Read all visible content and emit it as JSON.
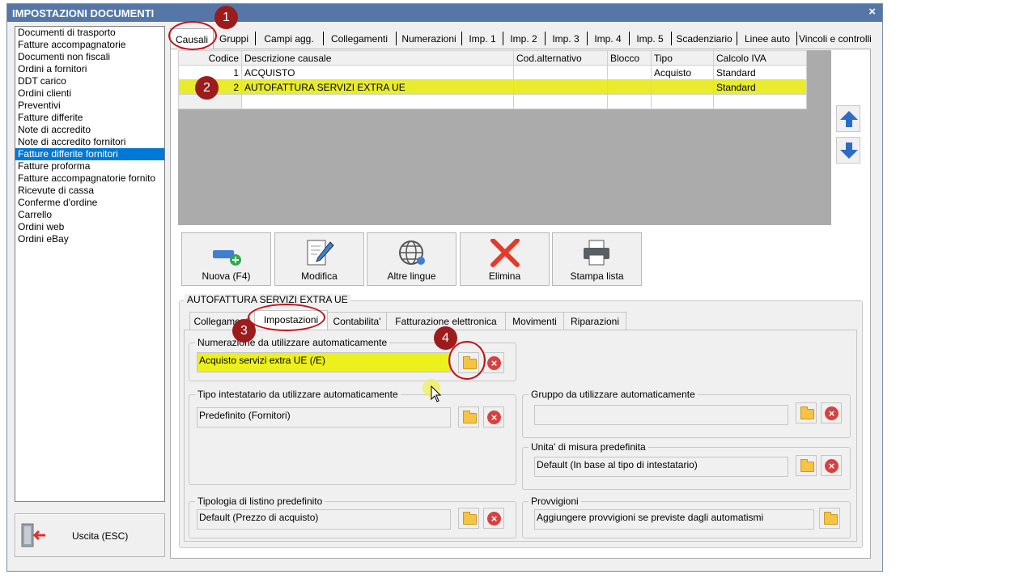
{
  "window": {
    "title": "IMPOSTAZIONI DOCUMENTI",
    "close": "×"
  },
  "doc_list": [
    "Documenti di trasporto",
    "Fatture accompagnatorie",
    "Documenti non fiscali",
    "Ordini a fornitori",
    "DDT carico",
    "Ordini clienti",
    "Preventivi",
    "Fatture differite",
    "Note di accredito",
    "Note di accredito fornitori",
    "Fatture differite fornitori",
    "Fatture proforma",
    "Fatture accompagnatorie fornito",
    "Ricevute di cassa",
    "Conferme d'ordine",
    "Carrello",
    "Ordini web",
    "Ordini eBay"
  ],
  "selected_doc": "Fatture differite fornitori",
  "exit_button": "Uscita (ESC)",
  "tabs": [
    "Causali",
    "Gruppi",
    "Campi agg.",
    "Collegamenti",
    "Numerazioni",
    "Imp. 1",
    "Imp. 2",
    "Imp. 3",
    "Imp. 4",
    "Imp. 5",
    "Scadenziario",
    "Linee auto",
    "Vincoli e controlli"
  ],
  "grid": {
    "headers": [
      "Codice",
      "Descrizione causale",
      "Cod.alternativo",
      "Blocco",
      "Tipo",
      "Calcolo IVA"
    ],
    "rows": [
      [
        "1",
        "ACQUISTO",
        "",
        "",
        "Acquisto",
        "Standard"
      ],
      [
        "2",
        "AUTOFATTURA SERVIZI EXTRA UE",
        "",
        "",
        "",
        "Standard"
      ]
    ]
  },
  "actions": [
    "Nuova (F4)",
    "Modifica",
    "Altre lingue",
    "Elimina",
    "Stampa lista"
  ],
  "detail": {
    "title": "AUTOFATTURA SERVIZI EXTRA UE",
    "subtabs": [
      "Collegamenti",
      "Impostazioni",
      "Contabilita'",
      "Fatturazione elettronica",
      "Movimenti",
      "Riparazioni"
    ],
    "numerazione": {
      "label": "Numerazione da utilizzare automaticamente",
      "value": "Acquisto servizi extra UE (/E)"
    },
    "tipo_intestatario": {
      "label": "Tipo intestatario da utilizzare automaticamente",
      "value": "Predefinito (Fornitori)"
    },
    "gruppo": {
      "label": "Gruppo da utilizzare automaticamente",
      "value": ""
    },
    "unita_misura": {
      "label": "Unita' di misura predefinita",
      "value": "Default (In base al tipo di intestatario)"
    },
    "listino": {
      "label": "Tipologia di listino predefinito",
      "value": "Default (Prezzo di acquisto)"
    },
    "provvigioni": {
      "label": "Provvigioni",
      "value": "Aggiungere provvigioni se previste dagli automatismi"
    }
  },
  "callouts": [
    "1",
    "2",
    "3",
    "4"
  ],
  "colors": {
    "title_bar": "#5577a8",
    "highlight": "#e8ec2d",
    "selection": "#0078d7",
    "callout": "#9c1c1c"
  }
}
